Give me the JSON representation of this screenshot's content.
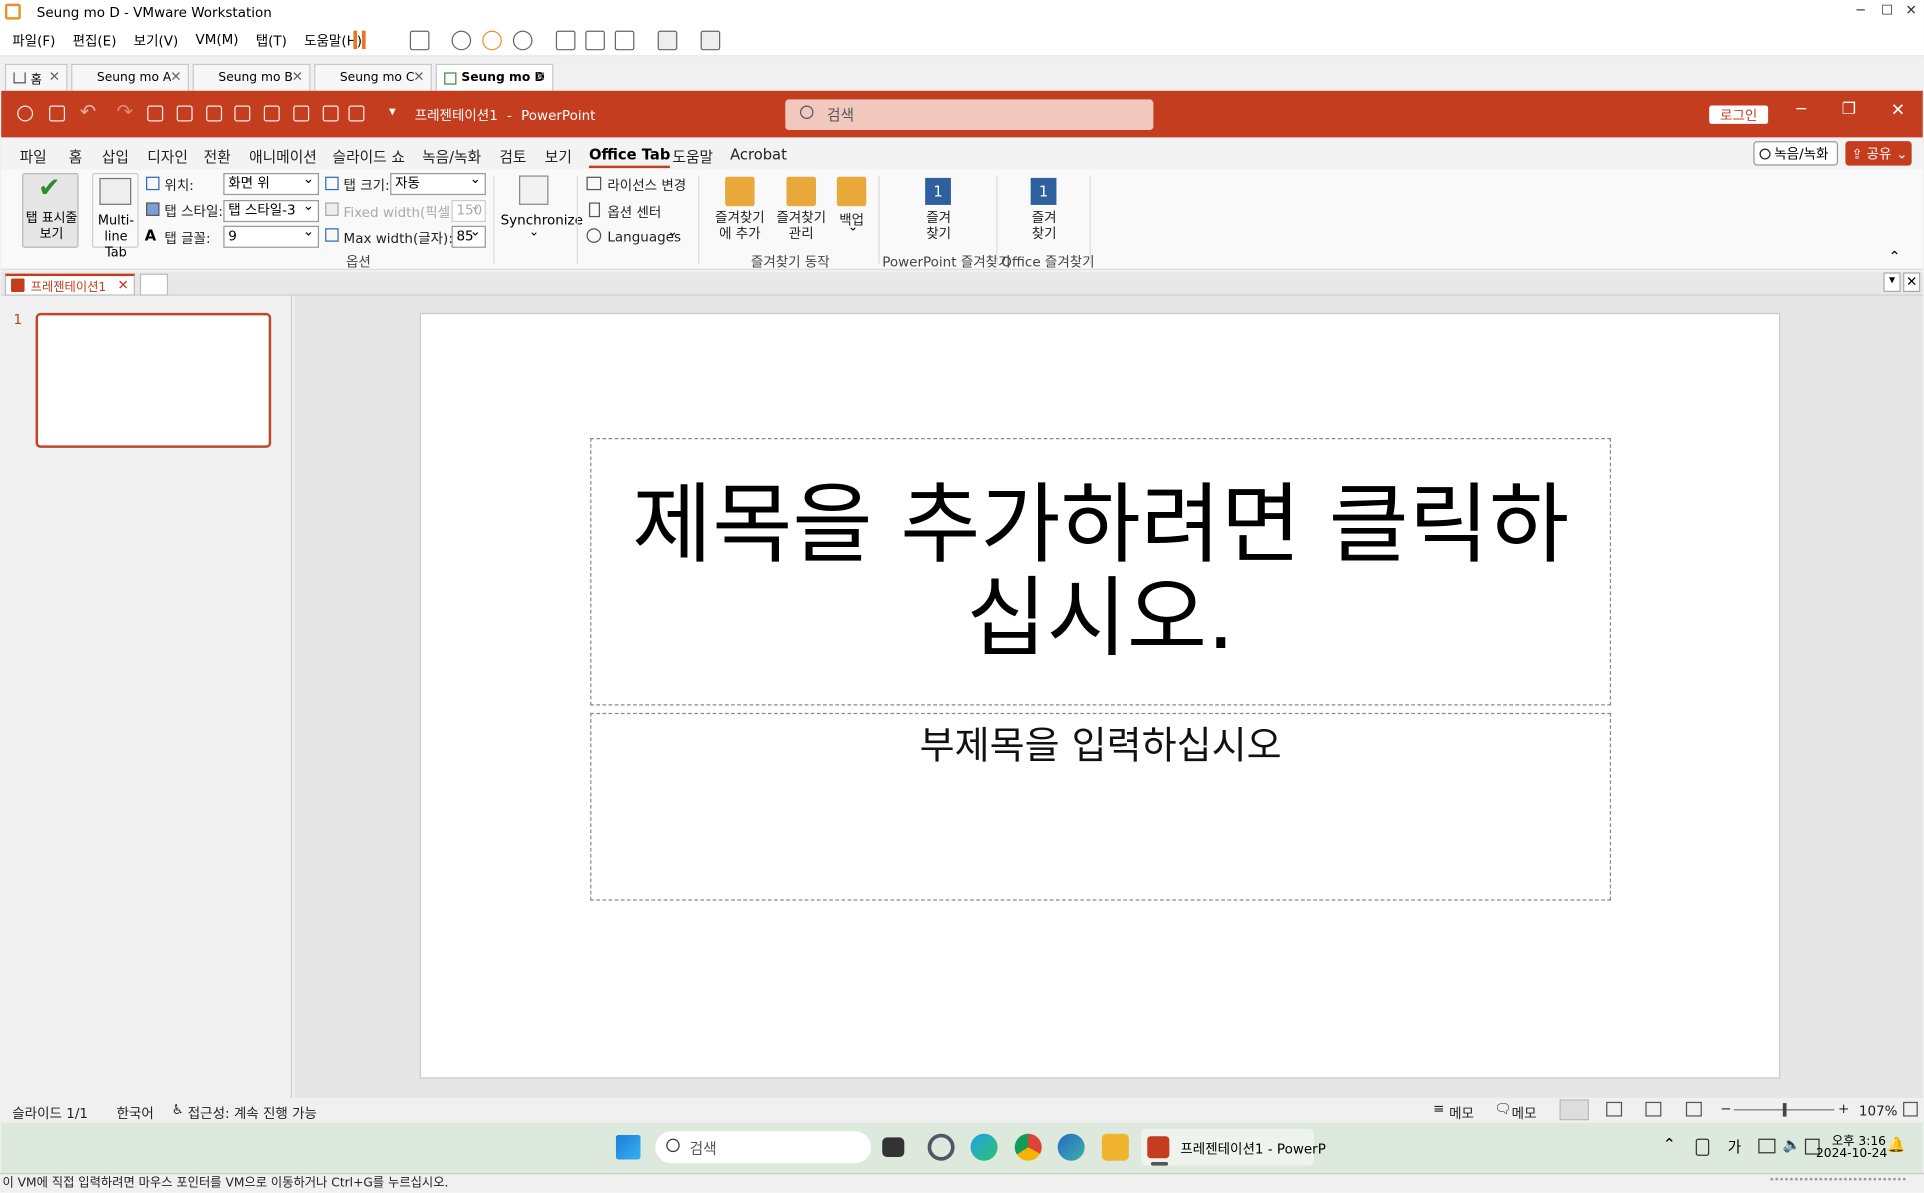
{
  "vmware": {
    "title": "Seung mo D - VMware Workstation",
    "menu": [
      "파일(F)",
      "편집(E)",
      "보기(V)",
      "VM(M)",
      "탭(T)",
      "도움말(H)"
    ],
    "tabs": [
      {
        "label": "홈"
      },
      {
        "label": "Seung mo A"
      },
      {
        "label": "Seung mo B"
      },
      {
        "label": "Seung mo C"
      },
      {
        "label": "Seung mo D"
      }
    ],
    "status_message": "이 VM에 직접 입력하려면 마우스 포인터를 VM으로 이동하거나 Ctrl+G를 누르십시오."
  },
  "powerpoint": {
    "doc_title": "프레젠테이션1",
    "app_name": "PowerPoint",
    "title_sep": "-",
    "search_placeholder": "검색",
    "login_label": "로그인",
    "record_label": "녹음/녹화",
    "share_label": "공유",
    "ribbon_tabs": [
      "파일",
      "홈",
      "삽입",
      "디자인",
      "전환",
      "애니메이션",
      "슬라이드 쇼",
      "녹음/녹화",
      "검토",
      "보기",
      "Office Tab",
      "도움말",
      "Acrobat"
    ],
    "active_tab": "Office Tab",
    "ribbon": {
      "show_tabs": "탭 표시줄 보기",
      "multiline": "Multi- line Tab",
      "position_label": "위치:",
      "position_value": "화면 위",
      "style_label": "탭 스타일:",
      "style_value": "탭 스타일-3",
      "font_label": "탭 글꼴:",
      "font_value": "9",
      "size_label": "탭 크기:",
      "size_value": "자동",
      "fixed_width_label": "Fixed width(픽셀):",
      "fixed_width_value": "150",
      "max_width_label": "Max width(글자):",
      "max_width_value": "85",
      "options_group": "옵션",
      "synchronize": "Synchronize",
      "license_change": "라이선스 변경",
      "option_center": "옵션 센터",
      "languages": "Languages",
      "fav_add": "즐겨찾기에 추가",
      "fav_manage": "즐겨찾기 관리",
      "backup": "백업",
      "fav_actions_group": "즐겨찾기 동작",
      "fav1": "즐겨 찾기",
      "fav1_group": "PowerPoint 즐겨찾기",
      "fav2": "즐겨 찾기",
      "fav2_group": "Office 즐겨찾기",
      "fav_badge": "1"
    },
    "doc_tab": "프레젠테이션1",
    "slide_number": "1",
    "slide": {
      "title_placeholder": "제목을 추가하려면 클릭하십시오.",
      "subtitle_placeholder": "부제목을 입력하십시오"
    },
    "status": {
      "slide_count": "슬라이드 1/1",
      "language": "한국어",
      "accessibility": "접근성: 계속 진행 가능",
      "notes": "메모",
      "comments": "메모",
      "zoom": "107%",
      "zoom_minus": "−",
      "zoom_plus": "+"
    }
  },
  "taskbar": {
    "search_placeholder": "검색",
    "app_label": "프레젠테이션1 - PowerP",
    "ime": "가",
    "time": "오후 3:16",
    "date": "2024-10-24"
  },
  "colors": {
    "ppt_accent": "#c33d1e",
    "thumb_border": "#c0452b"
  }
}
